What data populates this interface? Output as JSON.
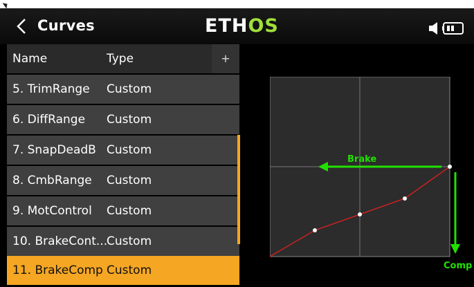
{
  "header": {
    "title": "Curves",
    "logo_prefix": "ETH",
    "logo_suffix": "OS",
    "logo_suffix_color": "#9fe03a",
    "icons": [
      "back-arrow-icon",
      "speaker-icon",
      "battery-icon"
    ]
  },
  "list": {
    "columns": {
      "name": "Name",
      "type": "Type"
    },
    "add_label": "+",
    "rows": [
      {
        "name": "5. TrimRange",
        "type": "Custom"
      },
      {
        "name": "6. DiffRange",
        "type": "Custom"
      },
      {
        "name": "7. SnapDeadB",
        "type": "Custom"
      },
      {
        "name": "8. CmbRange",
        "type": "Custom"
      },
      {
        "name": "9. MotControl",
        "type": "Custom"
      },
      {
        "name": "10. BrakeCont...",
        "type": "Custom"
      },
      {
        "name": "11. BrakeComp",
        "type": "Custom"
      }
    ],
    "selected_index": 6,
    "selected_color": "#f5a623"
  },
  "graph": {
    "annotation_brake": "Brake",
    "annotation_comp": "Comp",
    "annotation_color": "#22e000",
    "curve_color": "#cc2222"
  }
}
